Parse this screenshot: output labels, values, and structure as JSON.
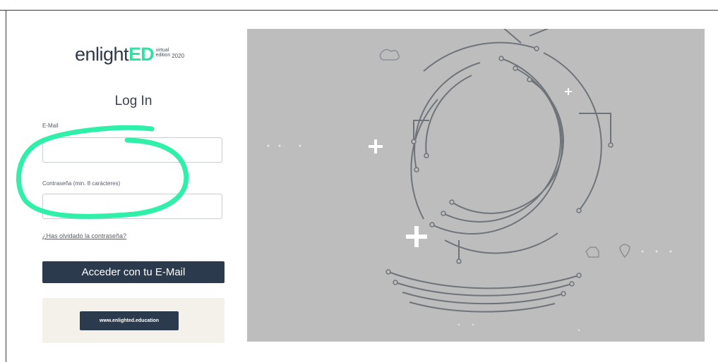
{
  "logo": {
    "brand_main": "enlight",
    "brand_accent": "ED",
    "side_top": "virtual",
    "side_bottom": "edition",
    "edition_year": "2020",
    "tagline": ""
  },
  "login": {
    "title": "Log In",
    "email_label": "E-Mail",
    "email_value": "",
    "password_label": "Contraseña (min. 8 carácteres)",
    "password_value": "",
    "forgot_link": "¿Has olvidado la contraseña?",
    "submit_label": "Acceder con tu E-Mail"
  },
  "footer": {
    "website_button": "www.enlighted.education"
  },
  "colors": {
    "accent": "#2ee3a2",
    "button_bg": "#2c3a4e",
    "hero_bg": "#bdbdbd",
    "annotation": "#2ef0a8"
  },
  "icons": [
    "plus-icon",
    "cloud-icon",
    "dog-icon",
    "location-pin-icon",
    "circuit-ring-graphic"
  ]
}
